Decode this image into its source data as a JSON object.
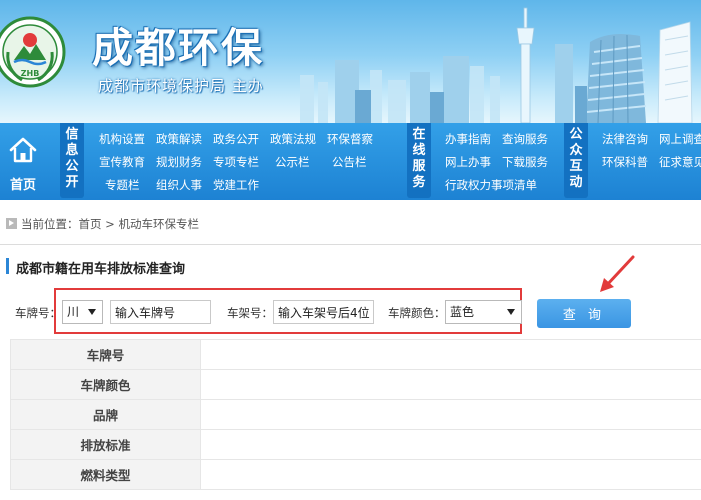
{
  "header": {
    "site_title": "成都环保",
    "site_subtitle": "成都市环境保护局  主办",
    "emblem_text": "ZHB"
  },
  "nav": {
    "home_label": "首页",
    "categories": [
      {
        "chars": [
          "信",
          "息",
          "公",
          "开"
        ]
      },
      {
        "chars": [
          "在",
          "线",
          "服",
          "务"
        ]
      },
      {
        "chars": [
          "公",
          "众",
          "互",
          "动"
        ]
      }
    ],
    "group1": {
      "row1": [
        "机构设置",
        "政策解读",
        "政务公开",
        "政策法规",
        "环保督察"
      ],
      "row2": [
        "宣传教育",
        "规划财务",
        "专项专栏",
        "公示栏",
        "公告栏"
      ],
      "row3": [
        "专题栏",
        "组织人事",
        "党建工作"
      ]
    },
    "group2": {
      "row1": [
        "办事指南",
        "查询服务"
      ],
      "row2": [
        "网上办事",
        "下载服务"
      ],
      "row3": [
        "行政权力事项清单"
      ]
    },
    "group3": {
      "row1": [
        "法律咨询",
        "网上调查"
      ],
      "row2": [
        "环保科普",
        "征求意见"
      ]
    }
  },
  "breadcrumb": {
    "prefix": "当前位置：",
    "home": "首页",
    "separator": " > ",
    "current": "机动车环保专栏"
  },
  "section": {
    "title": "成都市籍在用车排放标准查询"
  },
  "form": {
    "plate_label": "车牌号：",
    "plate_prefix_value": "川",
    "plate_input_value": "输入车牌号",
    "frame_label": "车架号：",
    "frame_input_value": "输入车架号后4位",
    "color_label": "车牌颜色：",
    "color_value": "蓝色",
    "query_button": "查 询"
  },
  "results": {
    "rows": [
      {
        "label": "车牌号",
        "value": ""
      },
      {
        "label": "车牌颜色",
        "value": ""
      },
      {
        "label": "品牌",
        "value": ""
      },
      {
        "label": "排放标准",
        "value": ""
      },
      {
        "label": "燃料类型",
        "value": ""
      }
    ]
  },
  "colors": {
    "nav_blue": "#1d82d3",
    "category_blue": "#1371c1",
    "button_blue": "#3a95e3",
    "highlight_red": "#e23b3b",
    "emblem_green": "#2e8b3a"
  }
}
